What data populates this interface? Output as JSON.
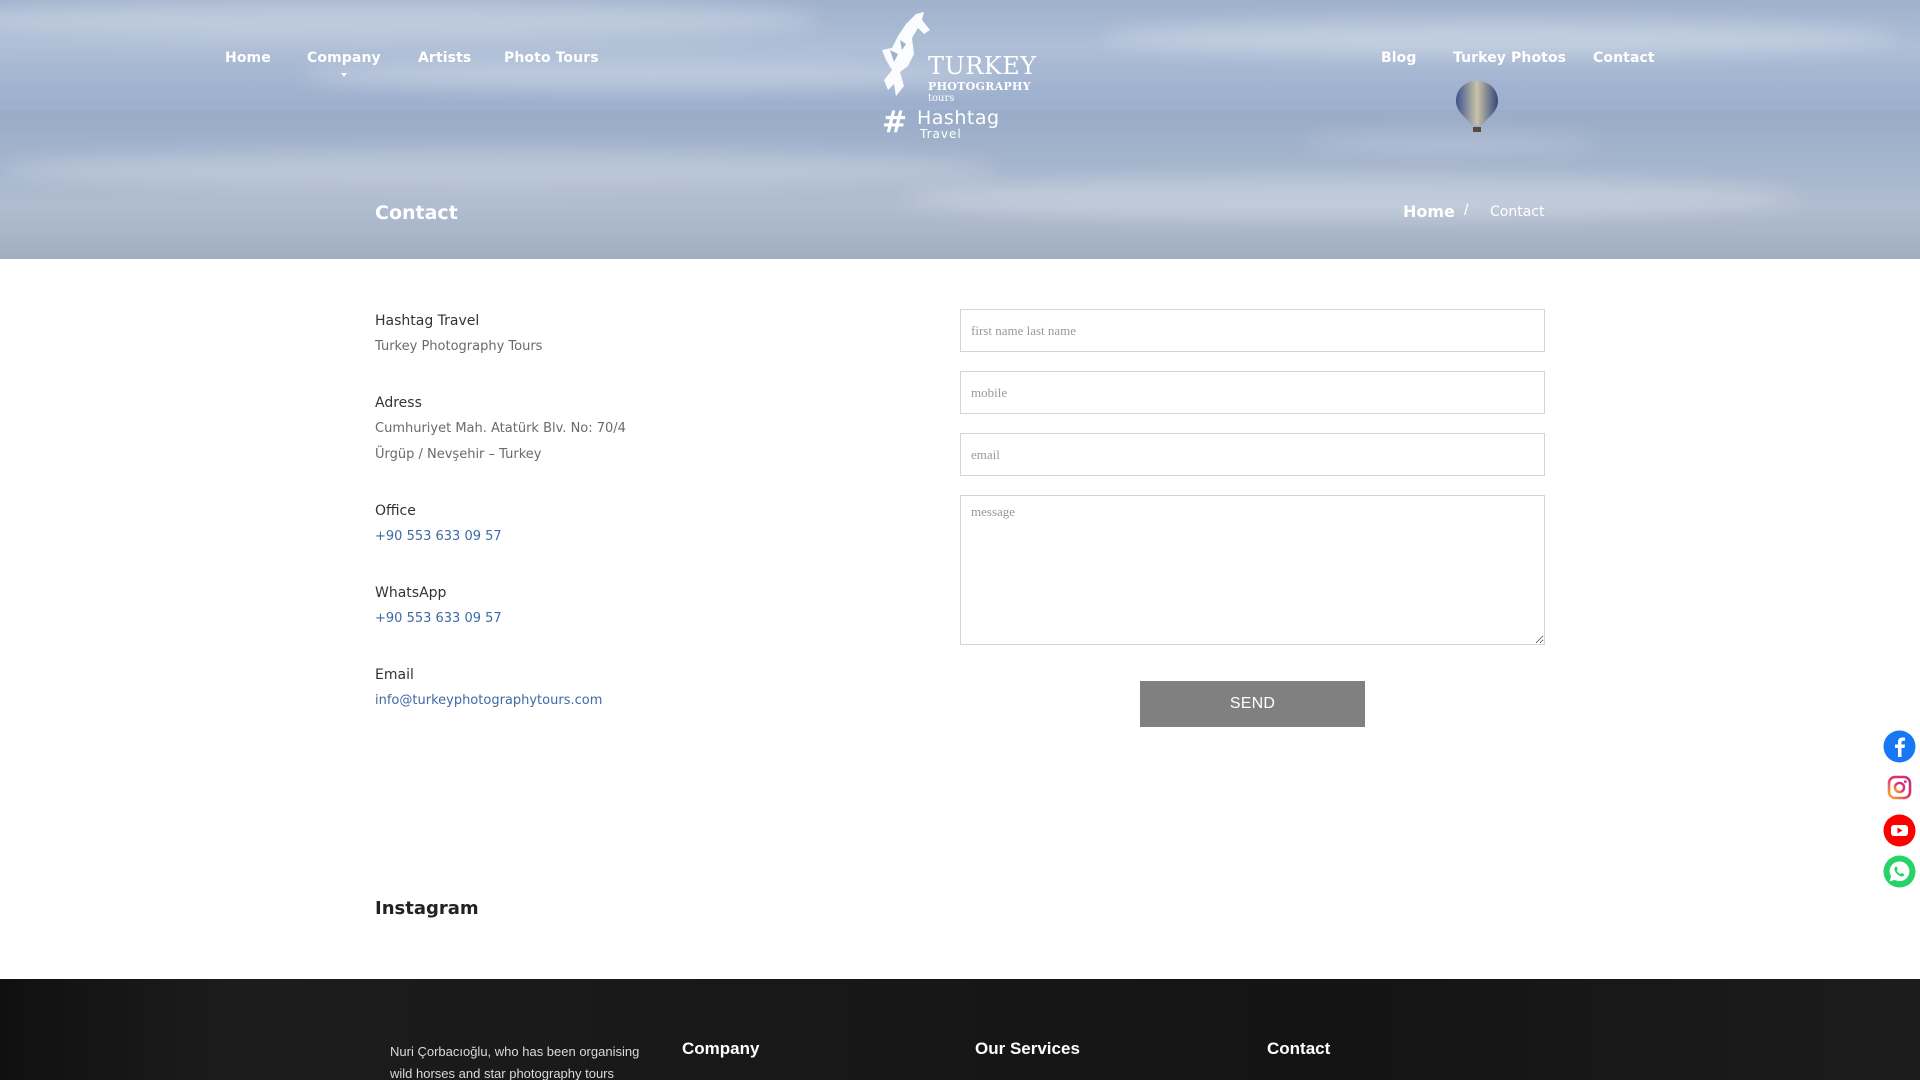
{
  "nav": {
    "left": [
      {
        "label": "Home"
      },
      {
        "label": "Company"
      },
      {
        "label": "Artists"
      },
      {
        "label": "Photo Tours"
      }
    ],
    "right": [
      {
        "label": "Blog"
      },
      {
        "label": "Turkey Photos"
      },
      {
        "label": "Contact"
      }
    ]
  },
  "logo": {
    "turkey": "TURKEY",
    "photography": "PHOTOGRAPHY",
    "tours": "tours",
    "hashtag": "Hashtag",
    "travel": "Travel"
  },
  "header": {
    "page_title": "Contact",
    "breadcrumb": {
      "home": "Home",
      "separator": "/",
      "current": "Contact"
    }
  },
  "contact_info": {
    "company_name": "Hashtag Travel",
    "company_sub": "Turkey Photography Tours",
    "address_label": "Adress",
    "address_line1": "Cumhuriyet Mah. Atatürk Blv. No: 70/4",
    "address_line2": "Ürgüp / Nevşehir – Turkey",
    "office_label": "Office",
    "office_phone": "+90 553 633 09 57",
    "whatsapp_label": "WhatsApp",
    "whatsapp_phone": "+90 553 633 09 57",
    "email_label": "Email",
    "email": "info@turkeyphotographytours.com"
  },
  "form": {
    "name_placeholder": "first name last name",
    "mobile_placeholder": "mobile",
    "email_placeholder": "email",
    "message_placeholder": "message",
    "send_label": "SEND"
  },
  "instagram": {
    "title": "Instagram"
  },
  "social": {
    "icons": [
      "facebook-icon",
      "instagram-icon",
      "youtube-icon",
      "whatsapp-icon"
    ],
    "colors": {
      "facebook": "#1877f2",
      "youtube": "#ff0000",
      "whatsapp": "#25d366"
    }
  },
  "footer": {
    "about_text": "Nuri Çorbacıoğlu, who has been organising wild horses and star photography tours",
    "company_heading": "Company",
    "services_heading": "Our Services",
    "contact_heading": "Contact"
  },
  "colors": {
    "accent_link": "#3f6aa6",
    "button": "#808080",
    "footer_bg": "#141414"
  }
}
